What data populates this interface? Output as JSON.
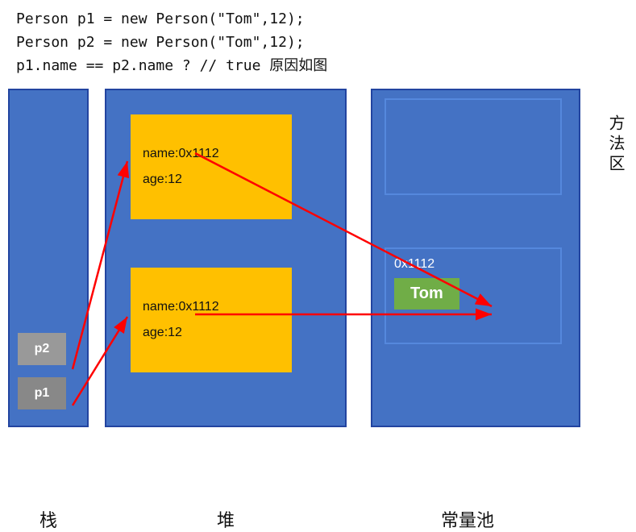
{
  "code": {
    "line1": "Person p1 = new Person(\"Tom\",12);",
    "line2": "Person p2 = new Person(\"Tom\",12);",
    "line3": "p1.name == p2.name ? // true  原因如图"
  },
  "diagram": {
    "stack_label": "栈",
    "heap_label": "堆",
    "pool_label": "常量池",
    "method_area_label": "方法区",
    "p1_label": "p1",
    "p2_label": "p2",
    "obj1": {
      "name": "name:0x1112",
      "age": "age:12"
    },
    "obj2": {
      "name": "name:0x1112",
      "age": "age:12"
    },
    "address": "0x1112",
    "tom_value": "Tom"
  }
}
